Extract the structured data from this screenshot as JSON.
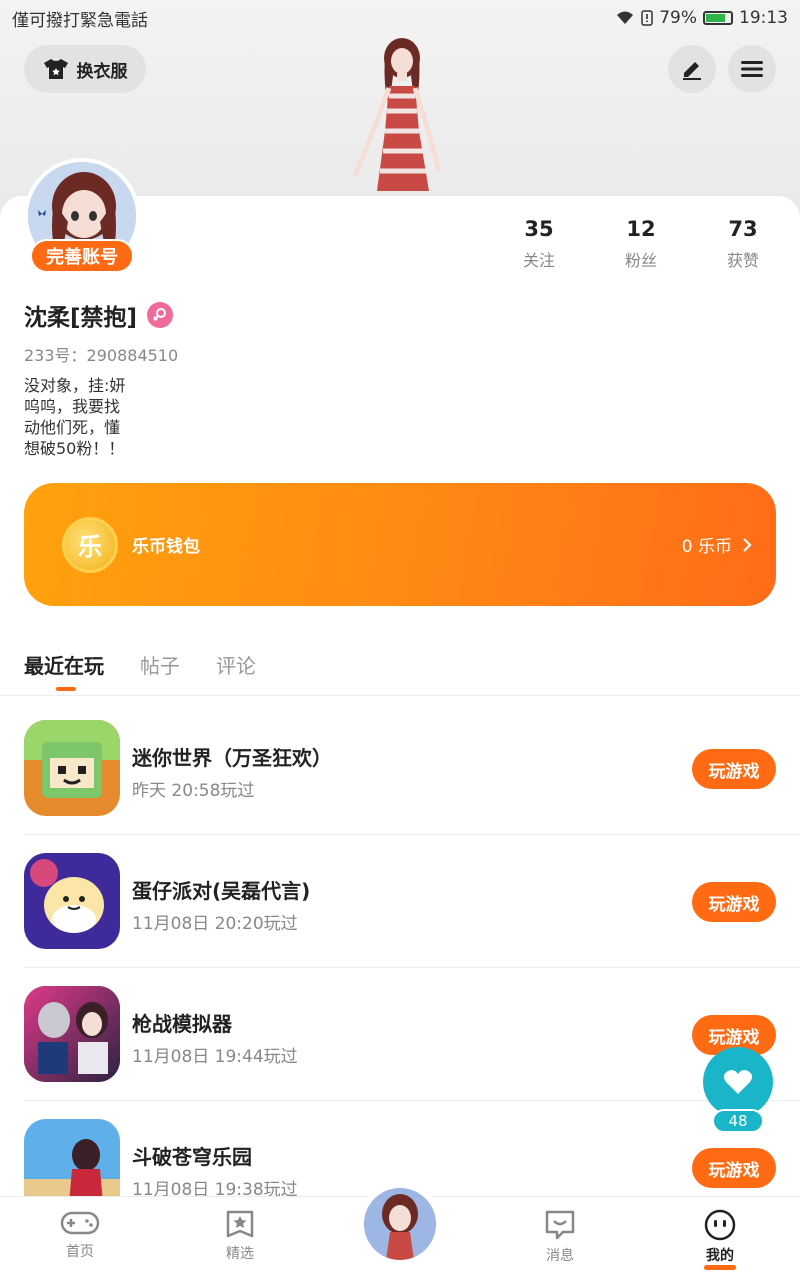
{
  "status_bar": {
    "left_text": "僅可撥打緊急電話",
    "battery_percent": "79%",
    "battery_level": 0.79,
    "time": "19:13"
  },
  "header": {
    "outfit_button_label": "换衣服",
    "edit_icon": "pencil-icon",
    "menu_icon": "menu-icon"
  },
  "profile": {
    "complete_account_label": "完善账号",
    "stats": [
      {
        "value": "35",
        "label": "关注"
      },
      {
        "value": "12",
        "label": "粉丝"
      },
      {
        "value": "73",
        "label": "获赞"
      }
    ],
    "username": "沈柔[禁抱]",
    "gender": "female",
    "user_id": "233号：290884510",
    "bio": "没对象，挂:妍\n呜呜，我要找\n动他们死，懂\n想破50粉！！"
  },
  "wallet": {
    "coin_char": "乐",
    "title": "乐币钱包",
    "balance": "0 乐币"
  },
  "tabs": [
    {
      "label": "最近在玩",
      "active": true
    },
    {
      "label": "帖子",
      "active": false
    },
    {
      "label": "评论",
      "active": false
    }
  ],
  "games": [
    {
      "name": "迷你世界（万圣狂欢）",
      "time": "昨天 20:58玩过",
      "button": "玩游戏",
      "icon_color": "#6fbf4e"
    },
    {
      "name": "蛋仔派对(吴磊代言)",
      "time": "11月08日 20:20玩过",
      "button": "玩游戏",
      "icon_color": "#4a3ca8"
    },
    {
      "name": "枪战模拟器",
      "time": "11月08日 19:44玩过",
      "button": "玩游戏",
      "icon_color": "#2a2240"
    },
    {
      "name": "斗破苍穹乐园",
      "time": "11月08日 19:38玩过",
      "button": "玩游戏",
      "icon_color": "#3d8fd6"
    }
  ],
  "like_fab": {
    "count": "48"
  },
  "bottom_nav": [
    {
      "label": "首页",
      "icon": "gamepad-icon",
      "active": false
    },
    {
      "label": "精选",
      "icon": "star-bookmark-icon",
      "active": false
    },
    {
      "label": "",
      "icon": "avatar-center",
      "active": false
    },
    {
      "label": "消息",
      "icon": "message-icon",
      "active": false
    },
    {
      "label": "我的",
      "icon": "profile-face-icon",
      "active": true
    }
  ],
  "colors": {
    "accent": "#ff6a12",
    "teal": "#1bb5c9",
    "pink": "#f06a9a"
  }
}
